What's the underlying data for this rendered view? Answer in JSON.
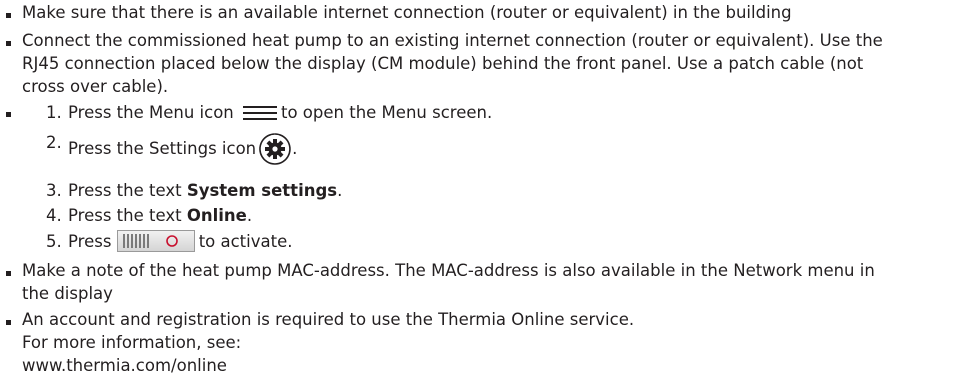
{
  "items": {
    "b1": "Make sure that there is an available internet connection (router or equivalent) in the building",
    "b2_l1": "Connect the commissioned heat pump to an existing internet connection (router or equivalent). Use the",
    "b2_l2": "RJ45 connection placed below the display (CM module) behind the front panel. Use a patch cable (not",
    "b2_l3": "cross over cable).",
    "steps": [
      {
        "num": "1.",
        "pre": "Press the Menu icon",
        "post": "to open the Menu screen."
      },
      {
        "num": "2.",
        "pre": "Press the Settings icon",
        "post": "."
      },
      {
        "num": "3.",
        "pre": "Press the text ",
        "bold": "System settings",
        "post": "."
      },
      {
        "num": "4.",
        "pre": "Press the text ",
        "bold": "Online",
        "post": "."
      },
      {
        "num": "5.",
        "pre": "Press",
        "post": "to activate."
      }
    ],
    "b4_l1": "Make a note of the heat pump MAC-address. The MAC-address is also available in the Network menu in",
    "b4_l2": "the display",
    "b5_l1": "An account and registration is required to use the Thermia Online service.",
    "b5_l2": "For more information, see:",
    "b5_l3": "www.thermia.com/online"
  },
  "icons": {
    "menu": "menu-lines-icon",
    "settings": "gear-icon",
    "toggle": "toggle-switch-icon"
  },
  "colors": {
    "text": "#231f20",
    "toggle_ring": "#c8102e"
  }
}
